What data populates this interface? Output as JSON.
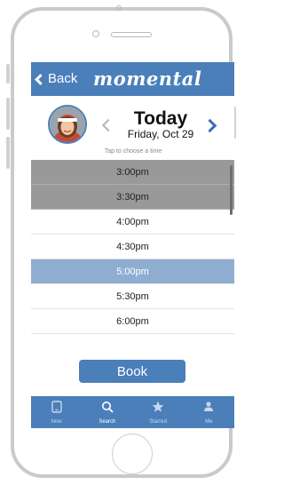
{
  "colors": {
    "accent": "#4a7fba",
    "booked": "#999999",
    "selected": "#8fadd1"
  },
  "nav": {
    "back_label": "Back",
    "app_name": "momental"
  },
  "header": {
    "day": "Today",
    "date": "Friday, Oct 29",
    "hint": "Tap to choose a time"
  },
  "slots": [
    {
      "time": "3:00pm",
      "state": "booked"
    },
    {
      "time": "3:30pm",
      "state": "booked"
    },
    {
      "time": "4:00pm",
      "state": "available"
    },
    {
      "time": "4:30pm",
      "state": "available"
    },
    {
      "time": "5:00pm",
      "state": "selected"
    },
    {
      "time": "5:30pm",
      "state": "available"
    },
    {
      "time": "6:00pm",
      "state": "available"
    }
  ],
  "book_label": "Book",
  "tabs": [
    {
      "label": "Now",
      "icon": "phone-icon"
    },
    {
      "label": "Search",
      "icon": "search-icon"
    },
    {
      "label": "Starred",
      "icon": "star-icon"
    },
    {
      "label": "Me",
      "icon": "person-icon"
    }
  ]
}
